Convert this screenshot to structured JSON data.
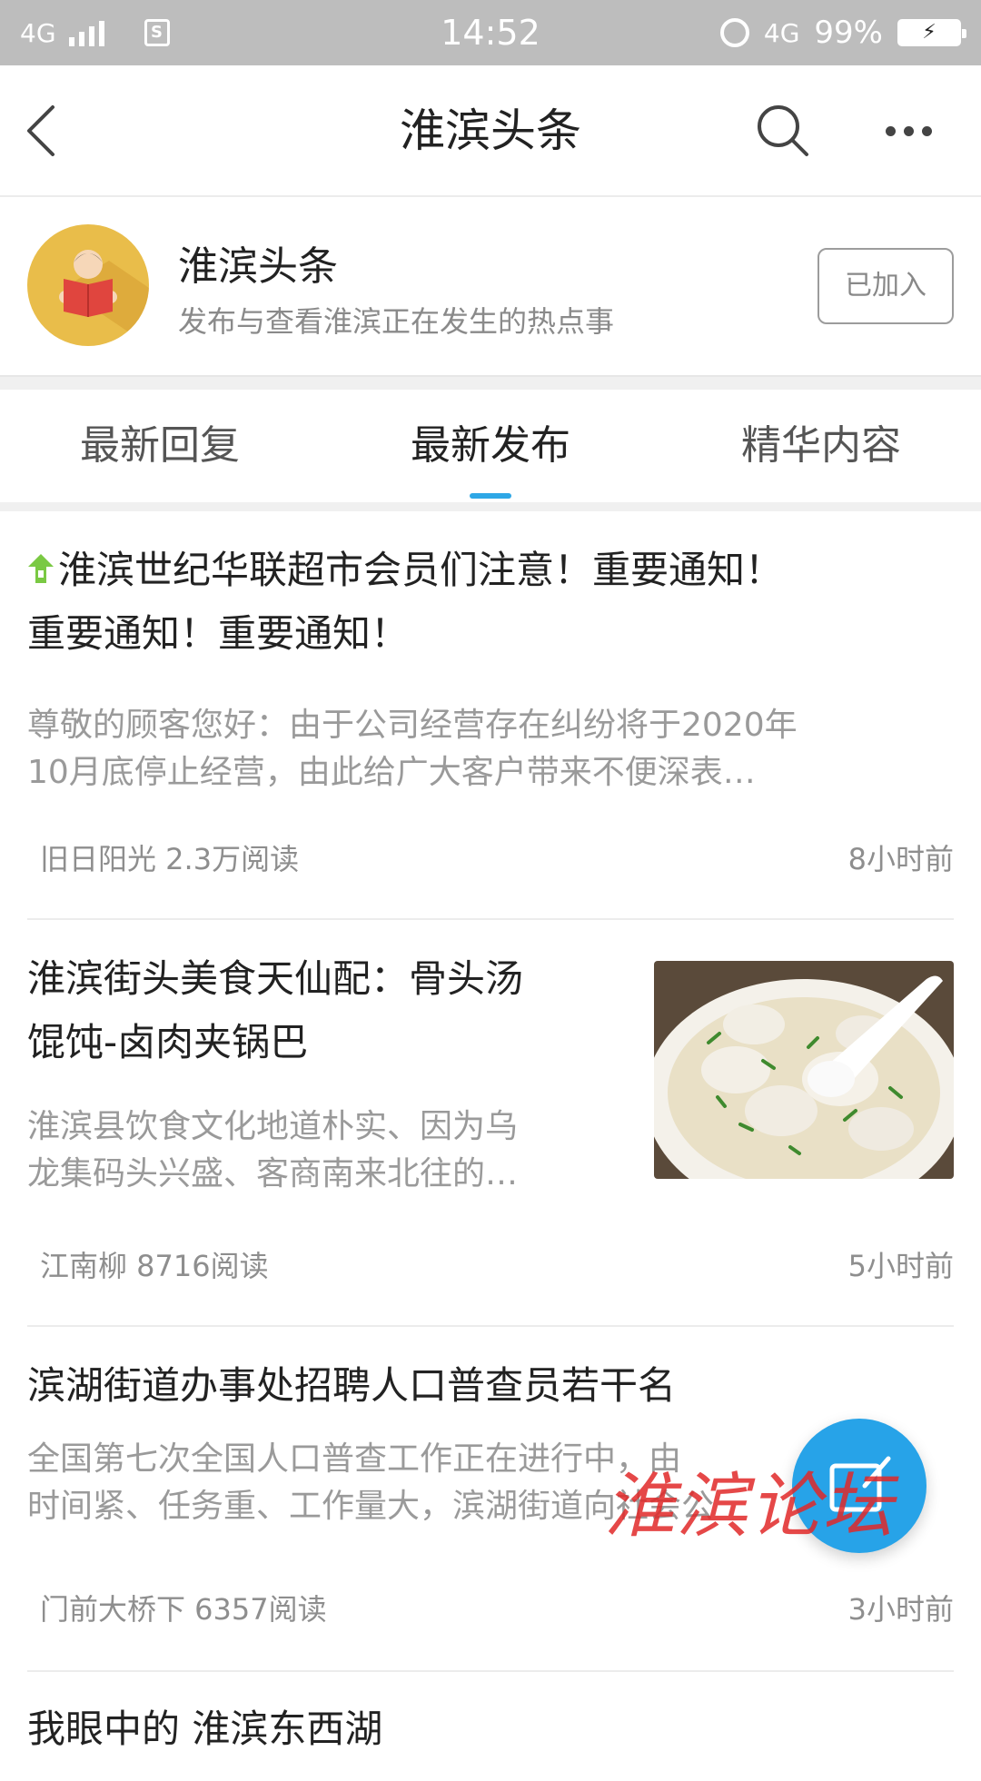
{
  "status_bar": {
    "network_left": "4G",
    "time": "14:52",
    "network_right": "4G",
    "battery_percent": "99%"
  },
  "nav": {
    "title": "淮滨头条"
  },
  "group": {
    "name": "淮滨头条",
    "description": "发布与查看淮滨正在发生的热点事",
    "join_label": "已加入"
  },
  "tabs": [
    {
      "label": "最新回复",
      "active": false
    },
    {
      "label": "最新发布",
      "active": true
    },
    {
      "label": "精华内容",
      "active": false
    }
  ],
  "posts": [
    {
      "pinned": true,
      "title_line1": "淮滨世纪华联超市会员们注意！重要通知！",
      "title_line2": "重要通知！重要通知！",
      "excerpt_line1": "尊敬的顾客您好：由于公司经营存在纠纷将于2020年",
      "excerpt_line2": "10月底停止经营，由此给广大客户带来不便深表…",
      "meta": "旧日阳光 2.3万阅读",
      "time": "8小时前"
    },
    {
      "pinned": false,
      "title_line1": "淮滨街头美食天仙配：骨头汤",
      "title_line2": "馄饨-卤肉夹锅巴",
      "excerpt_line1": "淮滨县饮食文化地道朴实、因为乌",
      "excerpt_line2": "龙集码头兴盛、客商南来北往的…",
      "meta": "江南柳 8716阅读",
      "time": "5小时前",
      "thumbnail": "wonton-soup-bowl"
    },
    {
      "pinned": false,
      "title_line1": "滨湖街道办事处招聘人口普查员若干名",
      "excerpt_line1": "全国第七次全国人口普查工作正在进行中，由",
      "excerpt_line2": "时间紧、任务重、工作量大，滨湖街道向社会公",
      "meta": "门前大桥下 6357阅读",
      "time": "3小时前"
    },
    {
      "pinned": false,
      "title_line1": "我眼中的 淮滨东西湖"
    }
  ],
  "watermark": "淮滨论坛",
  "colors": {
    "accent": "#2ea7e6",
    "fab": "#27a3e8",
    "pin": "#7ac943",
    "status_bar_bg": "#bdbdbd",
    "avatar_bg": "#e9bd4a"
  }
}
